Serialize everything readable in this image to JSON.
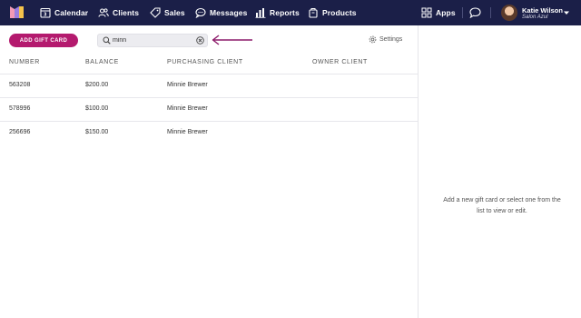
{
  "nav": {
    "items": [
      {
        "label": "Calendar",
        "icon": "calendar-icon"
      },
      {
        "label": "Clients",
        "icon": "clients-icon"
      },
      {
        "label": "Sales",
        "icon": "tag-icon"
      },
      {
        "label": "Messages",
        "icon": "messages-icon"
      },
      {
        "label": "Reports",
        "icon": "reports-icon"
      },
      {
        "label": "Products",
        "icon": "products-icon"
      }
    ],
    "apps_label": "Apps",
    "user_name": "Katie Wilson",
    "user_location": "Salon Azul"
  },
  "toolbar": {
    "add_button_label": "ADD GIFT CARD",
    "search_value": "minn",
    "settings_label": "Settings"
  },
  "table": {
    "columns": [
      "NUMBER",
      "BALANCE",
      "PURCHASING CLIENT",
      "OWNER CLIENT"
    ],
    "rows": [
      {
        "number": "563208",
        "balance": "$200.00",
        "purchasing_client": "Minnie Brewer",
        "owner_client": ""
      },
      {
        "number": "578996",
        "balance": "$100.00",
        "purchasing_client": "Minnie Brewer",
        "owner_client": ""
      },
      {
        "number": "256696",
        "balance": "$150.00",
        "purchasing_client": "Minnie Brewer",
        "owner_client": ""
      }
    ]
  },
  "detail_panel": {
    "empty_message": "Add a new gift card or select one from the list to view or edit."
  },
  "colors": {
    "nav_background": "#1b1f48",
    "accent": "#b41a6e",
    "arrow": "#8c1a6a"
  }
}
